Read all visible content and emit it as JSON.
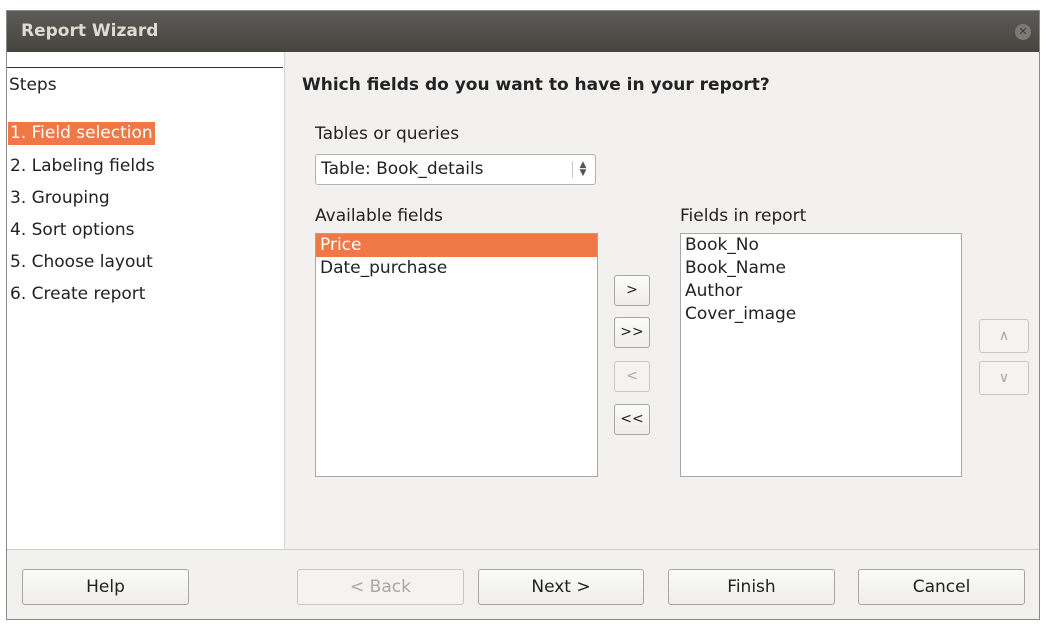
{
  "window": {
    "title": "Report Wizard"
  },
  "steps": {
    "title": "Steps",
    "items": [
      "1. Field selection",
      "2. Labeling fields",
      "3. Grouping",
      "4. Sort options",
      "5. Choose layout",
      "6. Create report"
    ],
    "active_index": 0
  },
  "main": {
    "heading": "Which fields do you want to have in your report?",
    "tables_label": "Tables or queries",
    "tables_value": "Table: Book_details",
    "available_label": "Available fields",
    "available_fields": [
      "Price",
      "Date_purchase"
    ],
    "available_selected": "Price",
    "report_label": "Fields in report",
    "report_fields": [
      "Book_No",
      "Book_Name",
      "Author",
      "Cover_image"
    ]
  },
  "move_buttons": {
    "add": ">",
    "add_all": ">>",
    "remove": "<",
    "remove_all": "<<"
  },
  "order_buttons": {
    "up": "^",
    "down": "v"
  },
  "footer": {
    "help": "Help",
    "back": "< Back",
    "next": "Next >",
    "finish": "Finish",
    "cancel": "Cancel"
  },
  "colors": {
    "accent": "#f07746",
    "titlebar": "#4f4e4a"
  }
}
